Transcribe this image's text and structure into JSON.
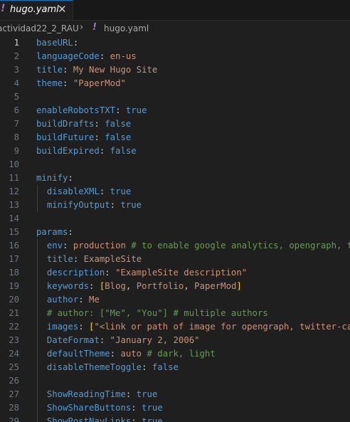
{
  "tab": {
    "icon": "yaml-icon",
    "label": "hugo.yaml",
    "close": "✕"
  },
  "breadcrumb": {
    "folder": "actividad22_2_RAU",
    "separator": "›",
    "file_icon": "yaml-icon",
    "file": "hugo.yaml"
  },
  "colors": {
    "key": "#569cd6",
    "string": "#ce9178",
    "comment": "#6a9955",
    "bracket": "#ffd700",
    "punctuation": "#cccccc"
  },
  "lines": [
    {
      "n": "1",
      "parts": [
        {
          "t": "baseURL",
          "c": "k"
        },
        {
          "t": ":",
          "c": "p"
        }
      ]
    },
    {
      "n": "2",
      "parts": [
        {
          "t": "languageCode",
          "c": "k"
        },
        {
          "t": ": ",
          "c": "p"
        },
        {
          "t": "en-us",
          "c": "s"
        }
      ]
    },
    {
      "n": "3",
      "parts": [
        {
          "t": "title",
          "c": "k"
        },
        {
          "t": ": ",
          "c": "p"
        },
        {
          "t": "My New Hugo Site",
          "c": "s"
        }
      ]
    },
    {
      "n": "4",
      "parts": [
        {
          "t": "theme",
          "c": "k"
        },
        {
          "t": ": ",
          "c": "p"
        },
        {
          "t": "\"PaperMod\"",
          "c": "s"
        }
      ]
    },
    {
      "n": "5",
      "parts": []
    },
    {
      "n": "6",
      "parts": [
        {
          "t": "enableRobotsTXT",
          "c": "k"
        },
        {
          "t": ": ",
          "c": "p"
        },
        {
          "t": "true",
          "c": "k"
        }
      ]
    },
    {
      "n": "7",
      "parts": [
        {
          "t": "buildDrafts",
          "c": "k"
        },
        {
          "t": ": ",
          "c": "p"
        },
        {
          "t": "false",
          "c": "k"
        }
      ]
    },
    {
      "n": "8",
      "parts": [
        {
          "t": "buildFuture",
          "c": "k"
        },
        {
          "t": ": ",
          "c": "p"
        },
        {
          "t": "false",
          "c": "k"
        }
      ]
    },
    {
      "n": "9",
      "parts": [
        {
          "t": "buildExpired",
          "c": "k"
        },
        {
          "t": ": ",
          "c": "p"
        },
        {
          "t": "false",
          "c": "k"
        }
      ]
    },
    {
      "n": "10",
      "parts": []
    },
    {
      "n": "11",
      "parts": [
        {
          "t": "minify",
          "c": "k"
        },
        {
          "t": ":",
          "c": "p"
        }
      ]
    },
    {
      "n": "12",
      "parts": [
        {
          "t": "  ",
          "c": "p"
        },
        {
          "t": "disableXML",
          "c": "k"
        },
        {
          "t": ": ",
          "c": "p"
        },
        {
          "t": "true",
          "c": "k"
        }
      ]
    },
    {
      "n": "13",
      "parts": [
        {
          "t": "  ",
          "c": "p"
        },
        {
          "t": "minifyOutput",
          "c": "k"
        },
        {
          "t": ": ",
          "c": "p"
        },
        {
          "t": "true",
          "c": "k"
        }
      ]
    },
    {
      "n": "14",
      "parts": []
    },
    {
      "n": "15",
      "parts": [
        {
          "t": "params",
          "c": "k"
        },
        {
          "t": ":",
          "c": "p"
        }
      ]
    },
    {
      "n": "16",
      "parts": [
        {
          "t": "  ",
          "c": "p"
        },
        {
          "t": "env",
          "c": "k"
        },
        {
          "t": ": ",
          "c": "p"
        },
        {
          "t": "production",
          "c": "s"
        },
        {
          "t": " # to enable google analytics, opengraph, twitter-cards and schema.",
          "c": "c"
        }
      ]
    },
    {
      "n": "17",
      "parts": [
        {
          "t": "  ",
          "c": "p"
        },
        {
          "t": "title",
          "c": "k"
        },
        {
          "t": ": ",
          "c": "p"
        },
        {
          "t": "ExampleSite",
          "c": "s"
        }
      ]
    },
    {
      "n": "18",
      "parts": [
        {
          "t": "  ",
          "c": "p"
        },
        {
          "t": "description",
          "c": "k"
        },
        {
          "t": ": ",
          "c": "p"
        },
        {
          "t": "\"ExampleSite description\"",
          "c": "s"
        }
      ]
    },
    {
      "n": "19",
      "parts": [
        {
          "t": "  ",
          "c": "p"
        },
        {
          "t": "keywords",
          "c": "k"
        },
        {
          "t": ": ",
          "c": "p"
        },
        {
          "t": "[",
          "c": "b"
        },
        {
          "t": "Blog",
          "c": "s"
        },
        {
          "t": ", ",
          "c": "p"
        },
        {
          "t": "Portfolio",
          "c": "s"
        },
        {
          "t": ", ",
          "c": "p"
        },
        {
          "t": "PaperMod",
          "c": "s"
        },
        {
          "t": "]",
          "c": "b"
        }
      ]
    },
    {
      "n": "20",
      "parts": [
        {
          "t": "  ",
          "c": "p"
        },
        {
          "t": "author",
          "c": "k"
        },
        {
          "t": ": ",
          "c": "p"
        },
        {
          "t": "Me",
          "c": "s"
        }
      ]
    },
    {
      "n": "21",
      "parts": [
        {
          "t": "  ",
          "c": "p"
        },
        {
          "t": "# author: [\"Me\", \"You\"] # multiple authors",
          "c": "c"
        }
      ]
    },
    {
      "n": "22",
      "parts": [
        {
          "t": "  ",
          "c": "p"
        },
        {
          "t": "images",
          "c": "k"
        },
        {
          "t": ": ",
          "c": "p"
        },
        {
          "t": "[",
          "c": "b"
        },
        {
          "t": "\"<link or path of image for opengraph, twitter-cards>\"",
          "c": "s"
        },
        {
          "t": "]",
          "c": "b"
        }
      ]
    },
    {
      "n": "23",
      "parts": [
        {
          "t": "  ",
          "c": "p"
        },
        {
          "t": "DateFormat",
          "c": "k"
        },
        {
          "t": ": ",
          "c": "p"
        },
        {
          "t": "\"January 2, 2006\"",
          "c": "s"
        }
      ]
    },
    {
      "n": "24",
      "parts": [
        {
          "t": "  ",
          "c": "p"
        },
        {
          "t": "defaultTheme",
          "c": "k"
        },
        {
          "t": ": ",
          "c": "p"
        },
        {
          "t": "auto",
          "c": "s"
        },
        {
          "t": " # dark, light",
          "c": "c"
        }
      ]
    },
    {
      "n": "25",
      "parts": [
        {
          "t": "  ",
          "c": "p"
        },
        {
          "t": "disableThemeToggle",
          "c": "k"
        },
        {
          "t": ": ",
          "c": "p"
        },
        {
          "t": "false",
          "c": "k"
        }
      ]
    },
    {
      "n": "26",
      "parts": []
    },
    {
      "n": "27",
      "parts": [
        {
          "t": "  ",
          "c": "p"
        },
        {
          "t": "ShowReadingTime",
          "c": "k"
        },
        {
          "t": ": ",
          "c": "p"
        },
        {
          "t": "true",
          "c": "k"
        }
      ]
    },
    {
      "n": "28",
      "parts": [
        {
          "t": "  ",
          "c": "p"
        },
        {
          "t": "ShowShareButtons",
          "c": "k"
        },
        {
          "t": ": ",
          "c": "p"
        },
        {
          "t": "true",
          "c": "k"
        }
      ]
    },
    {
      "n": "29",
      "parts": [
        {
          "t": "  ",
          "c": "p"
        },
        {
          "t": "ShowPostNavLinks",
          "c": "k"
        },
        {
          "t": ": ",
          "c": "p"
        },
        {
          "t": "true",
          "c": "k"
        }
      ]
    }
  ]
}
